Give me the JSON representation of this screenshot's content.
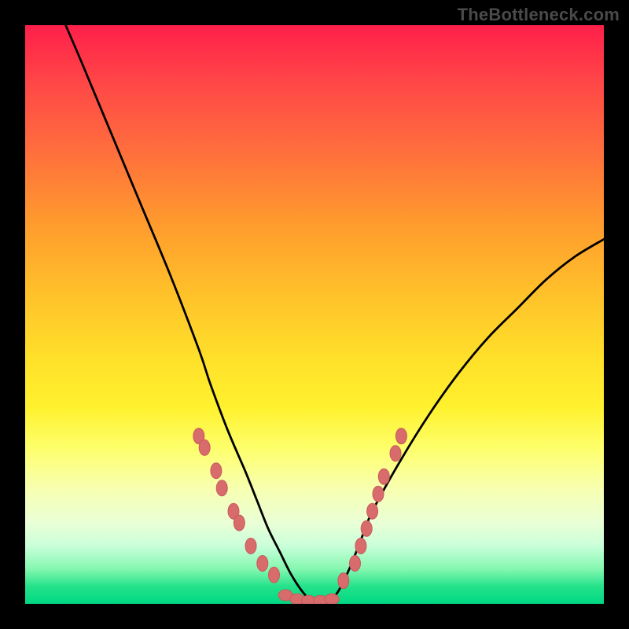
{
  "watermark": "TheBottleneck.com",
  "chart_data": {
    "type": "line",
    "title": "",
    "xlabel": "",
    "ylabel": "",
    "xlim": [
      0,
      100
    ],
    "ylim": [
      0,
      100
    ],
    "series": [
      {
        "name": "curve",
        "x": [
          7,
          10,
          15,
          20,
          25,
          30,
          32,
          35,
          38,
          40,
          42,
          44,
          46,
          48,
          50,
          52,
          54,
          56,
          58,
          60,
          65,
          70,
          75,
          80,
          85,
          90,
          95,
          100
        ],
        "y": [
          100,
          93,
          81,
          69,
          57,
          44,
          38,
          30,
          23,
          18,
          13,
          9,
          5,
          2,
          0,
          0,
          2,
          6,
          11,
          16,
          25,
          33,
          40,
          46,
          51,
          56,
          60,
          63
        ]
      }
    ],
    "markers": {
      "left_branch": [
        {
          "x": 30,
          "y": 29
        },
        {
          "x": 31,
          "y": 27
        },
        {
          "x": 33,
          "y": 23
        },
        {
          "x": 34,
          "y": 20
        },
        {
          "x": 36,
          "y": 16
        },
        {
          "x": 37,
          "y": 14
        },
        {
          "x": 39,
          "y": 10
        },
        {
          "x": 41,
          "y": 7
        },
        {
          "x": 43,
          "y": 5
        }
      ],
      "right_branch": [
        {
          "x": 55,
          "y": 4
        },
        {
          "x": 57,
          "y": 7
        },
        {
          "x": 58,
          "y": 10
        },
        {
          "x": 59,
          "y": 13
        },
        {
          "x": 60,
          "y": 16
        },
        {
          "x": 61,
          "y": 19
        },
        {
          "x": 62,
          "y": 22
        },
        {
          "x": 64,
          "y": 26
        },
        {
          "x": 65,
          "y": 29
        }
      ],
      "bottom": [
        {
          "x": 45,
          "y": 1.5
        },
        {
          "x": 47,
          "y": 0.8
        },
        {
          "x": 49,
          "y": 0.5
        },
        {
          "x": 51,
          "y": 0.5
        },
        {
          "x": 53,
          "y": 0.8
        }
      ]
    },
    "colors": {
      "curve": "#000000",
      "marker": "#d86b6b",
      "gradient_top": "#ff1f4a",
      "gradient_bottom": "#00d884"
    }
  }
}
